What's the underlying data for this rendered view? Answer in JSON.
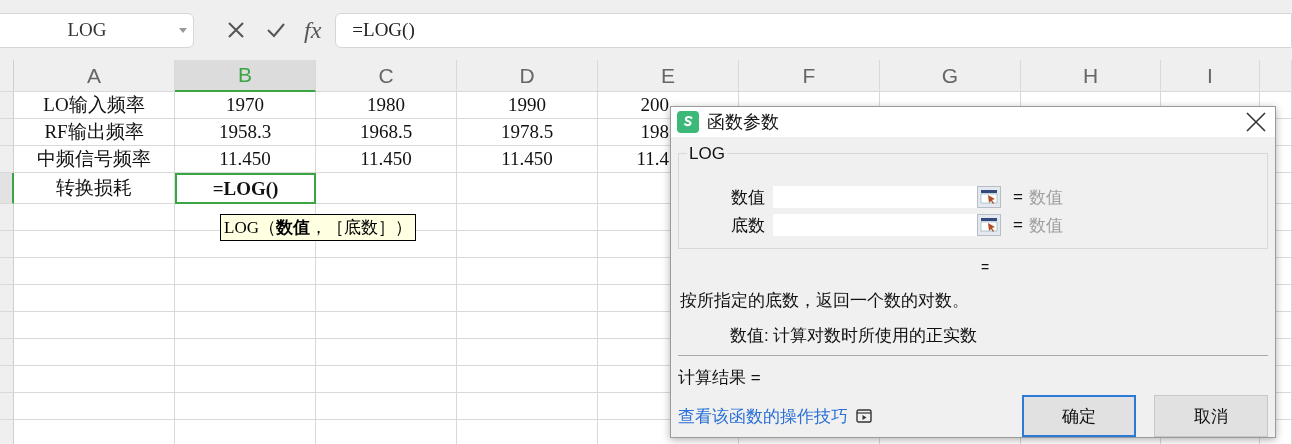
{
  "name_box": {
    "value": "LOG"
  },
  "formula_bar": {
    "fx_label": "fx",
    "value": "=LOG()"
  },
  "sheet": {
    "columns": [
      {
        "label": "A",
        "selected": false
      },
      {
        "label": "B",
        "selected": true
      },
      {
        "label": "C",
        "selected": false
      },
      {
        "label": "D",
        "selected": false
      },
      {
        "label": "E",
        "selected": false
      },
      {
        "label": "F",
        "selected": false
      },
      {
        "label": "G",
        "selected": false
      },
      {
        "label": "H",
        "selected": false
      },
      {
        "label": "I",
        "selected": false
      }
    ],
    "rows": [
      {
        "selected": false,
        "cells": [
          {
            "text": "LO输入频率",
            "selected": false
          },
          {
            "text": "1970",
            "selected": false
          },
          {
            "text": "1980",
            "selected": false
          },
          {
            "text": "1990",
            "selected": false
          },
          {
            "text": "200",
            "selected": false
          }
        ]
      },
      {
        "selected": false,
        "cells": [
          {
            "text": "RF输出频率",
            "selected": false
          },
          {
            "text": "1958.3",
            "selected": false
          },
          {
            "text": "1968.5",
            "selected": false
          },
          {
            "text": "1978.5",
            "selected": false
          },
          {
            "text": "198",
            "selected": false
          }
        ]
      },
      {
        "selected": false,
        "cells": [
          {
            "text": "中频信号频率",
            "selected": false
          },
          {
            "text": "11.450",
            "selected": false
          },
          {
            "text": "11.450",
            "selected": false
          },
          {
            "text": "11.450",
            "selected": false
          },
          {
            "text": "11.4",
            "selected": false
          }
        ]
      },
      {
        "selected": true,
        "cells": [
          {
            "text": "转换损耗",
            "selected": false
          },
          {
            "text": "=LOG()",
            "selected": true
          }
        ]
      }
    ],
    "tooltip": "LOG（**数值**，［底数］）"
  },
  "dialog": {
    "title": "函数参数",
    "group_title": "LOG",
    "arguments": [
      {
        "label": "数值",
        "equals": "=",
        "result": "数值"
      },
      {
        "label": "底数",
        "equals": "=",
        "result": "数值"
      }
    ],
    "formula_result": "=",
    "description": "按所指定的底数，返回一个数的对数。",
    "argument_help": "数值:  计算对数时所使用的正实数",
    "calc_result": "计算结果 =",
    "help_link": "查看该函数的操作技巧",
    "buttons": [
      {
        "label": "确定",
        "selected": true
      },
      {
        "label": "取消",
        "selected": false
      }
    ]
  }
}
